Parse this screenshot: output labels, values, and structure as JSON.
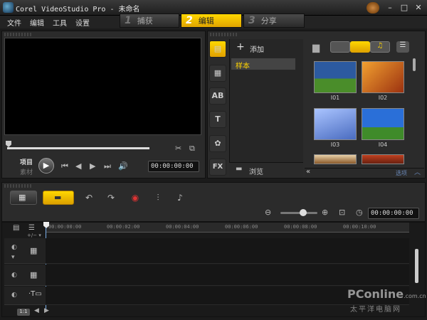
{
  "window": {
    "title": "Corel VideoStudio Pro - 未命名"
  },
  "menu": {
    "items": [
      "文件",
      "编辑",
      "工具",
      "设置"
    ]
  },
  "steps": [
    {
      "num": "1",
      "label": "捕获"
    },
    {
      "num": "2",
      "label": "编辑"
    },
    {
      "num": "3",
      "label": "分享"
    }
  ],
  "player": {
    "mode_project": "项目",
    "mode_clip": "素材",
    "timecode": "00:00:00:00"
  },
  "library": {
    "add_label": "添加",
    "folders": [
      "样本"
    ],
    "browse_label": "浏览",
    "options_label": "选项",
    "thumbnails": [
      {
        "label": "I01",
        "color": "#3a6fb0"
      },
      {
        "label": "I02",
        "color": "#c96a20"
      },
      {
        "label": "I03",
        "color": "#5a7fc8"
      },
      {
        "label": "I04",
        "color": "#2f6fd0"
      }
    ],
    "side_tabs": [
      "media",
      "transition",
      "title",
      "graphic",
      "filter"
    ]
  },
  "timeline": {
    "timecode": "00:00:00:00",
    "ruler_ticks": [
      "00:00:00:00",
      "00:00:02:00",
      "00:00:04:00",
      "00:00:06:00",
      "00:00:08:00",
      "00:00:10:00"
    ]
  },
  "watermark": {
    "brand": "PConline",
    "domain": ".com.cn",
    "subtitle": "太平洋电脑网"
  },
  "colors": {
    "accent": "#f5c400"
  }
}
